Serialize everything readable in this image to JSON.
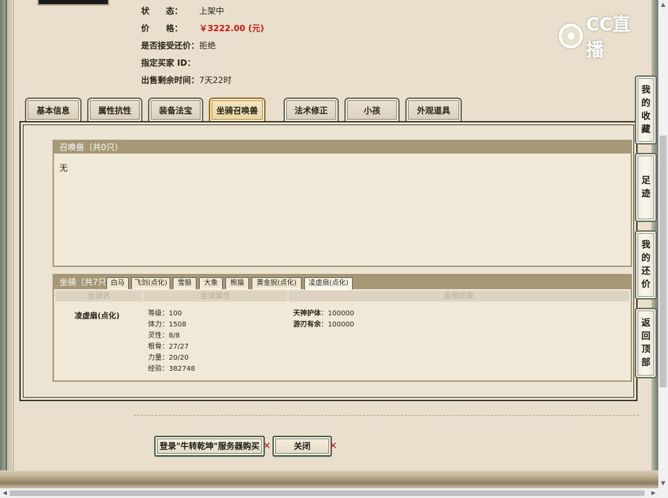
{
  "info": {
    "status_label": "状　　态：",
    "status_value": "上架中",
    "price_label": "价　　格：",
    "price_value": "￥3222.00 (元)",
    "counteroffer_label": "是否接受还价：",
    "counteroffer_value": "拒绝",
    "buyer_label": "指定买家 ID：",
    "buyer_value": "",
    "time_label": "出售剩余时间：",
    "time_value": "7天22时"
  },
  "watermark": {
    "text": "CC直播"
  },
  "tabs": [
    {
      "label": "基本信息"
    },
    {
      "label": "属性抗性"
    },
    {
      "label": "装备法宝"
    },
    {
      "label": "坐骑召唤兽"
    },
    {
      "label": "法术修正"
    },
    {
      "label": "小孩"
    },
    {
      "label": "外观道具"
    }
  ],
  "summon": {
    "header": "召唤兽（共0只）",
    "empty_text": "无"
  },
  "mount": {
    "header": "坐骑（共7只",
    "tabs": [
      {
        "label": "白马"
      },
      {
        "label": "飞剑(点化)"
      },
      {
        "label": "雪狼"
      },
      {
        "label": "大象"
      },
      {
        "label": "熊猫"
      },
      {
        "label": "黄金猊(点化)"
      },
      {
        "label": "凌虚扇(点化)"
      }
    ],
    "columns": [
      "坐骑名",
      "坐骑属性",
      "坐骑技能"
    ],
    "name": "凌虚扇(点化)",
    "attributes": [
      {
        "text": "等级：100"
      },
      {
        "text": "体力：1508"
      },
      {
        "text": "灵性：8/8"
      },
      {
        "text": "根骨：27/27"
      },
      {
        "text": "力量：20/20"
      },
      {
        "text": "经验：382748"
      }
    ],
    "skills": [
      {
        "name": "天神护体",
        "value": "：100000"
      },
      {
        "name": "游刃有余",
        "value": "：100000"
      }
    ]
  },
  "buttons": {
    "buy": "登录\"牛转乾坤\"服务器购买",
    "close": "关闭"
  },
  "side_nav": [
    {
      "chars": [
        "我",
        "的",
        "收",
        "藏"
      ]
    },
    {
      "chars": [
        "足",
        "迹"
      ]
    },
    {
      "chars": [
        "我",
        "的",
        "还",
        "价"
      ]
    },
    {
      "chars": [
        "返",
        "回",
        "顶",
        "部"
      ]
    }
  ],
  "colors": {
    "background": "#e4dac6",
    "price": "#d01818",
    "header_bar": "#a69877",
    "frame_green": "#5f6e5a",
    "active_tab_border": "#9a6a22"
  }
}
